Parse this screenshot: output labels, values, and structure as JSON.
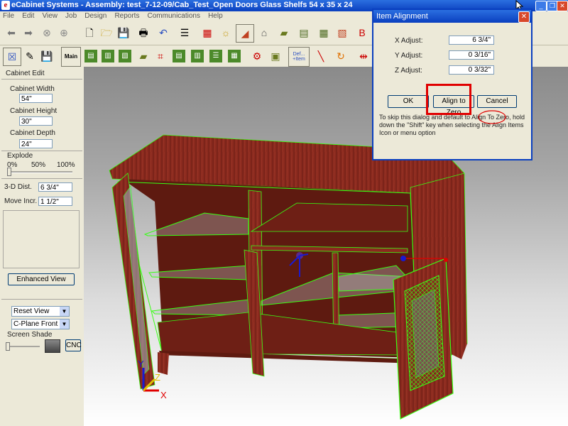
{
  "window": {
    "title": "eCabinet Systems - Assembly: test_7-12-09/Cab_Test_Open Doors Glass Shelfs 54 x 35 x 24"
  },
  "menu": [
    "File",
    "Edit",
    "View",
    "Job",
    "Design",
    "Reports",
    "Communications",
    "Help"
  ],
  "toolbar2": {
    "main_label": "Main",
    "def_label": "Def...\n+Item"
  },
  "left_panel": {
    "section_title": "Cabinet Edit",
    "width_label": "Cabinet Width",
    "width_value": "54\"",
    "height_label": "Cabinet Height",
    "height_value": "30\"",
    "depth_label": "Cabinet Depth",
    "depth_value": "24\"",
    "explode_label": "Explode",
    "explode_ticks": [
      "0%",
      "50%",
      "100%"
    ],
    "dist_label": "3-D Dist.",
    "dist_value": "6 3/4\"",
    "move_label": "Move Incr.",
    "move_value": "1 1/2\"",
    "enhanced_button": "Enhanced View",
    "view_select": "Reset View",
    "plane_select": "C-Plane Front",
    "screen_shade_label": "Screen Shade",
    "cnc_button": "CNC"
  },
  "dialog": {
    "title": "Item Alignment",
    "x_label": "X Adjust:",
    "x_value": "6 3/4\"",
    "y_label": "Y Adjust:",
    "y_value": "0 3/16\"",
    "z_label": "Z Adjust:",
    "z_value": "0 3/32\"",
    "ok_button": "OK",
    "align_zero_button": "Align to Zero",
    "cancel_button": "Cancel",
    "hint_text": "To skip this dialog and default to Align To Zero, hold down the \"Shift\" key when selecting the Align Items Icon or menu option"
  },
  "axes": {
    "x": "X",
    "y": "Y",
    "z": "Z"
  },
  "colors": {
    "accent": "#0a3fbf",
    "wood": "#8b2a1e",
    "highlight": "#39ff14",
    "callout": "#e00000"
  }
}
